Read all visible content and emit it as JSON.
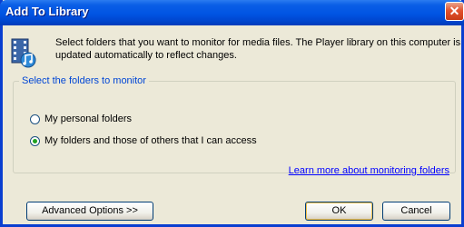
{
  "window": {
    "title": "Add To Library",
    "close_glyph": "✕"
  },
  "intro": {
    "text": "Select folders that you want to monitor for media files. The Player library on this computer is updated automatically to reflect changes.",
    "icon": "media-library-icon"
  },
  "folders_group": {
    "legend": "Select the folders to monitor",
    "options": [
      {
        "label": "My personal folders",
        "selected": false
      },
      {
        "label": "My folders and those of others that I can access",
        "selected": true
      }
    ],
    "learn_more_link": "Learn more about monitoring folders"
  },
  "buttons": {
    "advanced": "Advanced Options >>",
    "ok": "OK",
    "cancel": "Cancel"
  },
  "colors": {
    "titlebar": "#0054e3",
    "legend_text": "#0046d5",
    "link": "#0000ff",
    "dialog_bg": "#ece9d8"
  }
}
